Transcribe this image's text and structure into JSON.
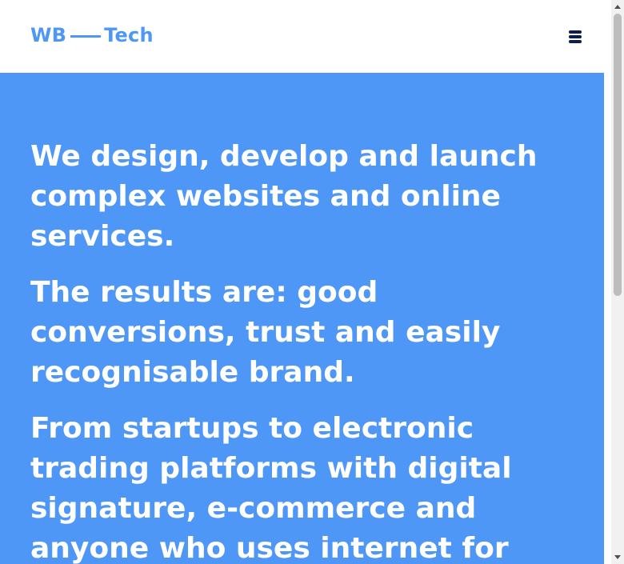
{
  "header": {
    "logo_left": "WB",
    "logo_right": "Tech",
    "menu_icon": "hamburger-menu-icon"
  },
  "hero": {
    "paragraphs": [
      "We design, develop and launch complex websites and online services.",
      "The results are: good conversions, trust and easily recognisable brand.",
      "From startups to electronic trading platforms with digital signature, e-commerce and anyone who uses internet for"
    ]
  },
  "colors": {
    "brand_blue": "#4f97f7",
    "menu_icon": "#0c1e4a",
    "hero_text": "#ffffff"
  },
  "scrollbar": {
    "up_icon": "scroll-up-arrow-icon",
    "down_icon": "scroll-down-arrow-icon"
  }
}
